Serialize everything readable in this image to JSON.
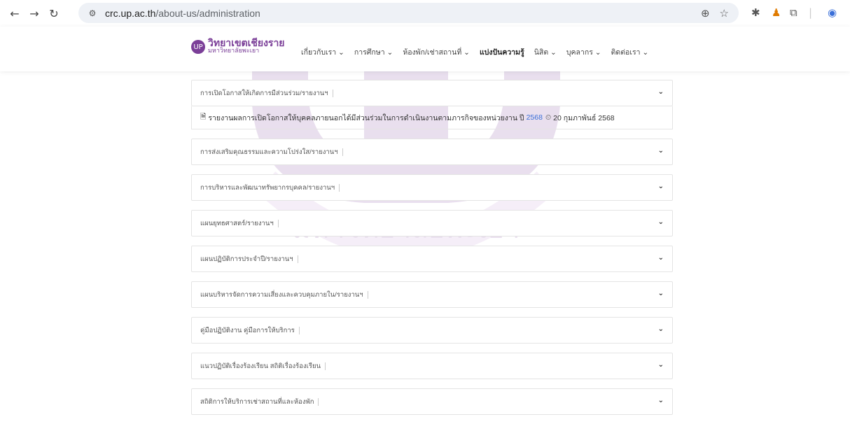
{
  "browser": {
    "url_domain": "crc.up.ac.th",
    "url_path": "/about-us/administration",
    "icons": [
      "back-icon",
      "forward-icon",
      "reload-icon",
      "site-info-icon",
      "zoom-icon",
      "star-icon",
      "extension-bug-icon",
      "extension-chess-icon",
      "puzzle-icon",
      "profile-icon"
    ]
  },
  "site": {
    "logo_line1": "วิทยาเขตเชียงราย",
    "logo_line2": "มหาวิทยาลัยพะเยา",
    "logo_mark": "UP",
    "nav": [
      {
        "label": "เกี่ยวกับเรา ⌄",
        "bold": false
      },
      {
        "label": "การศึกษา ⌄",
        "bold": false
      },
      {
        "label": "ห้องพัก/เช่าสถานที่ ⌄",
        "bold": false
      },
      {
        "label": "แบ่งปันความรู้",
        "bold": true
      },
      {
        "label": "นิสิต ⌄",
        "bold": false
      },
      {
        "label": "บุคลากร ⌄",
        "bold": false
      },
      {
        "label": "ติดต่อเรา ⌄",
        "bold": false
      }
    ]
  },
  "accordion": {
    "expanded_body": {
      "text": "รายงานผลการเปิดโอกาสให้บุคคลภายนอกได้มีส่วนร่วมในการดำเนินงานตามภารกิจของหน่วยงาน ปี",
      "year": "2568",
      "date": "20 กุมภาพันธ์ 2568"
    },
    "items": [
      {
        "label": "การเปิดโอกาสให้เกิดการมีส่วนร่วม/รายงานฯ"
      },
      {
        "label": "การส่งเสริมคุณธรรมและความโปร่งใส/รายงานฯ"
      },
      {
        "label": "การบริหารและพัฒนาทรัพยากรบุคคล/รายงานฯ"
      },
      {
        "label": "แผนยุทธศาสตร์/รายงานฯ"
      },
      {
        "label": "แผนปฏิบัติการประจำปี/รายงานฯ"
      },
      {
        "label": "แผนบริหารจัดการความเสี่ยงและควบคุมภายใน/รายงานฯ"
      },
      {
        "label": "คู่มือปฏิบัติงาน คู่มือการให้บริการ"
      },
      {
        "label": "แนวปฏิบัติเรื่องร้องเรียน สถิติเรื่องร้องเรียน"
      },
      {
        "label": "สถิติการให้บริการเช่าสถานที่และห้องพัก"
      }
    ]
  },
  "watermark_text": "UNIVERSITY OF PHAYAO",
  "watermark_thai": "มหาวิทยาลัยพะเยา"
}
